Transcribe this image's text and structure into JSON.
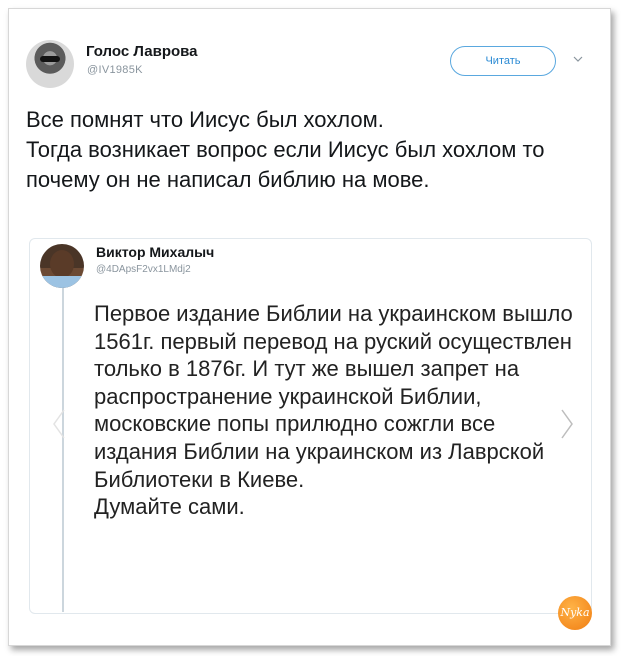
{
  "tweet": {
    "author_name": "Голос Лаврова",
    "author_handle": "@IV1985K",
    "follow_label": "Читать",
    "text": "Все помнят что Иисус был хохлом.\nТогда возникает вопрос если Иисус был хохлом то почему он не написал библию на мове."
  },
  "quoted_tweet": {
    "author_name": "Виктор Михалыч",
    "author_handle": "@4DApsF2vx1LMdj2",
    "text": "Первое издание Библии на украинском вышло 1561г. первый перевод на руский осуществлен только в 1876г. И тут же вышел запрет на распространение украинской Библии, московские попы прилюдно сожгли все издания Библии на украинском из Лаврской Библиотеки в Киеве.\nДумайте сами."
  },
  "watermark": {
    "label": "Nyka"
  },
  "colors": {
    "accent": "#2a8ad4",
    "border": "#e1e8ed",
    "badge": "#f07d12"
  }
}
